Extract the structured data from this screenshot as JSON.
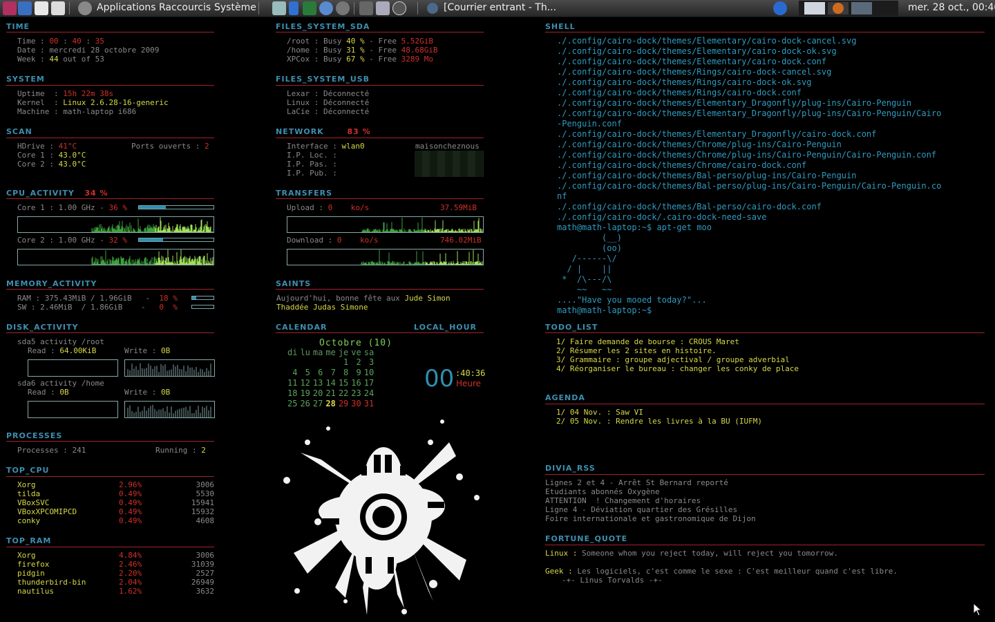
{
  "panel": {
    "menus": [
      "Applications",
      "Raccourcis",
      "Système"
    ],
    "window_title": "[Courrier entrant - Th...",
    "clock": "mer. 28 oct., 00:40"
  },
  "time": {
    "title": "TIME",
    "time_label": "Time",
    "time_h": "00",
    "time_m": "40",
    "time_s": "35",
    "date_label": "Date",
    "date": "mercredi 28 octobre 2009",
    "week_label": "Week",
    "week_num": "44",
    "week_text": "out of 53"
  },
  "system": {
    "title": "SYSTEM",
    "uptime_label": "Uptime",
    "uptime": "15h 22m 38s",
    "kernel_label": "Kernel",
    "kernel": "Linux 2.6.28-16-generic",
    "machine_label": "Machine",
    "machine": "math-laptop i686"
  },
  "scan": {
    "title": "SCAN",
    "hdrive_label": "HDrive",
    "hdrive": "41°C",
    "ports_label": "Ports ouverts",
    "ports": "2",
    "core1_label": "Core 1",
    "core1": "43.0°C",
    "core2_label": "Core 2",
    "core2": "43.0°C"
  },
  "cpu": {
    "title": "CPU_ACTIVITY",
    "total": "34 %",
    "core1_label": "Core 1",
    "core1_freq": "1.00 GHz",
    "core1_pct": "36 %",
    "core1_fraction": 0.36,
    "core2_label": "Core 2",
    "core2_freq": "1.00 GHz",
    "core2_pct": "32 %",
    "core2_fraction": 0.32
  },
  "memory": {
    "title": "MEMORY_ACTIVITY",
    "ram_label": "RAM",
    "ram": "375.43MiB / 1.96GiB",
    "ram_pct": "18",
    "ram_fraction": 0.18,
    "sw_label": "SW",
    "sw": "2.46MiB  / 1.86GiB",
    "sw_pct": "0",
    "sw_fraction": 0.0,
    "pct_sign": "%"
  },
  "disk": {
    "title": "DISK_ACTIVITY",
    "sda5": "sda5 activity /root",
    "sda5_read_label": "Read",
    "sda5_read": "64.00KiB",
    "sda5_write_label": "Write",
    "sda5_write": "0B",
    "sda6": "sda6 activity /home",
    "sda6_read_label": "Read",
    "sda6_read": "0B",
    "sda6_write_label": "Write",
    "sda6_write": "0B"
  },
  "processes": {
    "title": "PROCESSES",
    "count_label": "Processes",
    "count": "241",
    "running_label": "Running",
    "running": "2"
  },
  "top_cpu": {
    "title": "TOP_CPU",
    "rows": [
      {
        "name": "Xorg",
        "pct": "2.96%",
        "pid": "3006"
      },
      {
        "name": "tilda",
        "pct": "0.49%",
        "pid": "5530"
      },
      {
        "name": "VBoxSVC",
        "pct": "0.49%",
        "pid": "15941"
      },
      {
        "name": "VBoxXPCOMIPCD",
        "pct": "0.49%",
        "pid": "15932"
      },
      {
        "name": "conky",
        "pct": "0.49%",
        "pid": "4608"
      }
    ]
  },
  "top_ram": {
    "title": "TOP_RAM",
    "rows": [
      {
        "name": "Xorg",
        "pct": "4.84%",
        "pid": "3006"
      },
      {
        "name": "firefox",
        "pct": "2.46%",
        "pid": "31039"
      },
      {
        "name": "pidgin",
        "pct": "2.20%",
        "pid": "2527"
      },
      {
        "name": "thunderbird-bin",
        "pct": "2.04%",
        "pid": "26949"
      },
      {
        "name": "nautilus",
        "pct": "1.62%",
        "pid": "3632"
      }
    ]
  },
  "fs_sda": {
    "title": "FILES_SYSTEM_SDA",
    "rows": [
      {
        "mount": "/root",
        "busy": "40 %",
        "free": "5.52GiB"
      },
      {
        "mount": "/home",
        "busy": "31 %",
        "free": "48.68GiB"
      },
      {
        "mount": "XPCox",
        "busy": "67 %",
        "free": "3289 Mo"
      }
    ],
    "busy_label": "Busy",
    "free_label": "Free"
  },
  "fs_usb": {
    "title": "FILES_SYSTEM_USB",
    "rows": [
      {
        "name": "Lexar",
        "state": "Déconnecté"
      },
      {
        "name": "Linux",
        "state": "Déconnecté"
      },
      {
        "name": "LaCie",
        "state": "Déconnecté"
      }
    ]
  },
  "network": {
    "title": "NETWORK",
    "signal": "83 %",
    "iface_label": "Interface",
    "iface": "wlan0",
    "essid": "maisoncheznous",
    "loc_label": "I.P. Loc.",
    "pas_label": "I.P. Pas.",
    "pub_label": "I.P. Pub."
  },
  "transfers": {
    "title": "TRANSFERS",
    "up_label": "Upload",
    "up": "0",
    "up_unit": "ko/s",
    "up_total": "37.59MiB",
    "down_label": "Download",
    "down": "0",
    "down_unit": "ko/s",
    "down_total": "746.02MiB"
  },
  "saints": {
    "title": "SAINTS",
    "prefix": "Aujourd'hui, bonne fête aux",
    "line1": "Jude Simon",
    "line2": "Thaddée Judas Simone"
  },
  "calendar": {
    "title": "CALENDAR",
    "title2": "LOCAL_HOUR",
    "month": "Octobre (10)",
    "days": [
      "di",
      "lu",
      "ma",
      "me",
      "je",
      "ve",
      "sa"
    ],
    "weeks": [
      [
        "",
        "",
        "",
        "",
        "1",
        "2",
        "3"
      ],
      [
        "4",
        "5",
        "6",
        "7",
        "8",
        "9",
        "10"
      ],
      [
        "11",
        "12",
        "13",
        "14",
        "15",
        "16",
        "17"
      ],
      [
        "18",
        "19",
        "20",
        "21",
        "22",
        "23",
        "24"
      ],
      [
        "25",
        "26",
        "27",
        "28",
        "29",
        "30",
        "31"
      ]
    ],
    "today": "28",
    "hour": "00",
    "min_sec": ":40:36",
    "hour_label": "Heure"
  },
  "shell": {
    "title": "SHELL",
    "lines": [
      "./.config/cairo-dock/themes/Elementary/cairo-dock-cancel.svg",
      "./.config/cairo-dock/themes/Elementary/cairo-dock-ok.svg",
      "./.config/cairo-dock/themes/Elementary/cairo-dock.conf",
      "./.config/cairo-dock/themes/Rings/cairo-dock-cancel.svg",
      "./.config/cairo-dock/themes/Rings/cairo-dock-ok.svg",
      "./.config/cairo-dock/themes/Rings/cairo-dock.conf",
      "./.config/cairo-dock/themes/Elementary_Dragonfly/plug-ins/Cairo-Penguin",
      "./.config/cairo-dock/themes/Elementary_Dragonfly/plug-ins/Cairo-Penguin/Cairo",
      "-Penguin.conf",
      "./.config/cairo-dock/themes/Elementary_Dragonfly/cairo-dock.conf",
      "./.config/cairo-dock/themes/Chrome/plug-ins/Cairo-Penguin",
      "./.config/cairo-dock/themes/Chrome/plug-ins/Cairo-Penguin/Cairo-Penguin.conf",
      "./.config/cairo-dock/themes/Chrome/cairo-dock.conf",
      "./.config/cairo-dock/themes/Bal-perso/plug-ins/Cairo-Penguin",
      "./.config/cairo-dock/themes/Bal-perso/plug-ins/Cairo-Penguin/Cairo-Penguin.co",
      "nf",
      "./.config/cairo-dock/themes/Bal-perso/cairo-dock.conf",
      "./.config/cairo-dock/.cairo-dock-need-save",
      "math@math-laptop:~$ apt-get moo",
      "         (__)",
      "         (oo)",
      "   /------\\/",
      "  / |    ||",
      " *  /\\---/\\",
      "    ~~   ~~",
      "....\"Have you mooed today?\"...",
      "math@math-laptop:~$"
    ]
  },
  "todo": {
    "title": "TODO_LIST",
    "items": [
      "1/ Faire demande de bourse : CROUS Maret",
      "2/ Résumer les 2 sites en histoire.",
      "3/ Grammaire : groupe adjectival / groupe adverbial",
      "4/ Réorganiser le bureau : changer les conky de place"
    ]
  },
  "agenda": {
    "title": "AGENDA",
    "items": [
      "1/ 04 Nov. : Saw VI",
      "2/ 05 Nov. : Rendre les livres à la BU (IUFM)"
    ]
  },
  "rss": {
    "title": "DIVIA_RSS",
    "items": [
      "Lignes 2 et 4 - Arrêt St Bernard reporté",
      "Etudiants abonnés Oxygène",
      "ATTENTION  ! Changement d'horaires",
      "Ligne 4 - Déviation quartier des Grésilles",
      "Foire internationale et gastronomique de Dijon"
    ]
  },
  "fortune": {
    "title": "FORTUNE_QUOTE",
    "l1_label": "Linux :",
    "l1": "Someone whom you reject today, will reject you tomorrow.",
    "l2_label": "Geek :",
    "l2": "Les logiciels, c'est comme le sexe : C'est meilleur quand c'est libre.",
    "l3": "-+- Linus Torvalds -+-"
  },
  "colors": {
    "accent": "#3d8fb0",
    "rule": "#a3232a",
    "value": "#d8d84a",
    "alert": "#d0302a",
    "graph": "#7fd05a"
  }
}
